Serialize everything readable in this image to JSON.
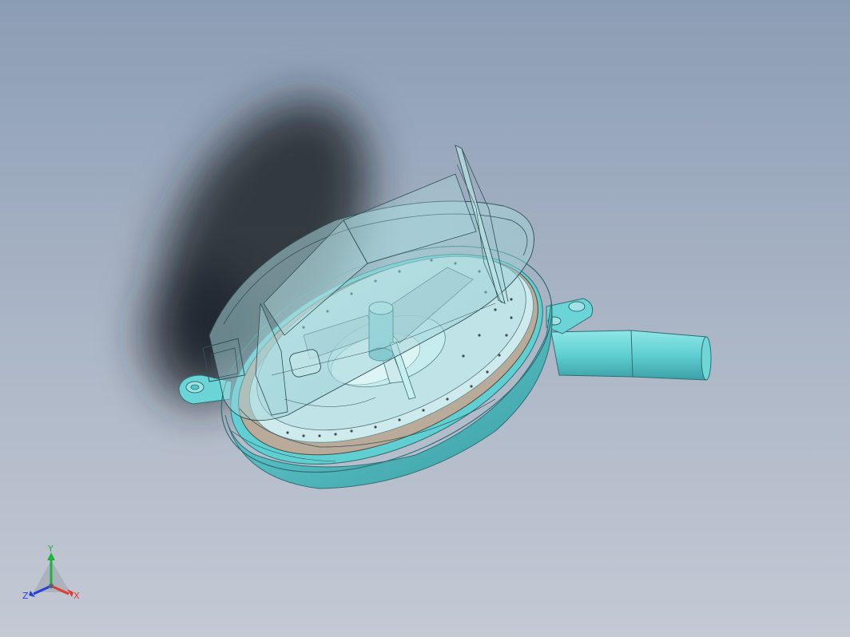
{
  "viewport": {
    "background_top": "#8b9db5",
    "background_bottom": "#c4c9d4"
  },
  "model": {
    "body_color": "#56c6c8",
    "body_shade": "#3aa0a6",
    "transparent_cover_color": "#9fd3d8",
    "floor_color": "#b9aa99",
    "shadow_color": "#1f252c"
  },
  "triad": {
    "x_label": "X",
    "y_label": "Y",
    "z_label": "Z",
    "x_color": "#e23a2f",
    "y_color": "#22b23c",
    "z_color": "#2740d8"
  }
}
